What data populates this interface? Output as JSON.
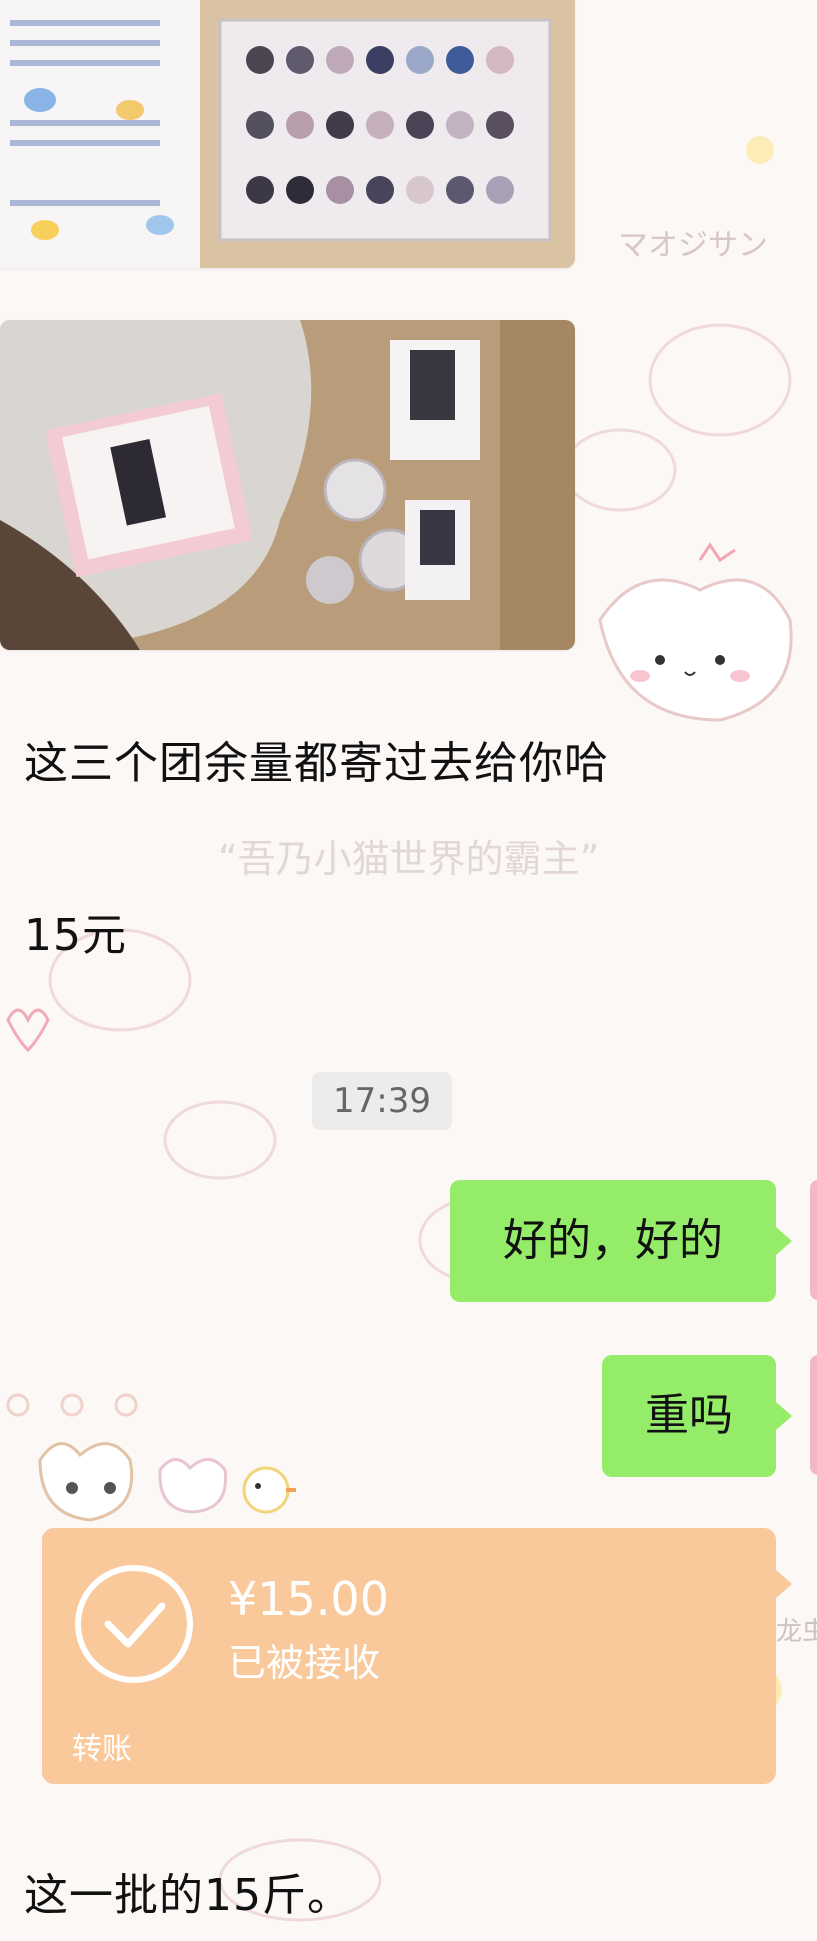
{
  "watermarks": {
    "top_right": "マオジサン",
    "middle": "“吾乃小猫世界的霸主”",
    "right_edge": "龙虫"
  },
  "messages": {
    "incoming_1": "这三个团余量都寄过去给你哈",
    "incoming_2": "15元",
    "timestamp": "17:39",
    "outgoing_1": "好的，好的",
    "outgoing_2": "重吗",
    "transfer": {
      "amount": "¥15.00",
      "status": "已被接收",
      "label": "转账"
    },
    "incoming_3": "这一批的15斤。"
  },
  "colors": {
    "outgoing_bubble": "#95ec69",
    "transfer_card": "#f9c99b",
    "timestamp_bg": "#ececec",
    "wallpaper": "#fbf8f6"
  },
  "images": {
    "photo_1": "photo-merch-keychains",
    "photo_2": "photo-merch-box"
  }
}
